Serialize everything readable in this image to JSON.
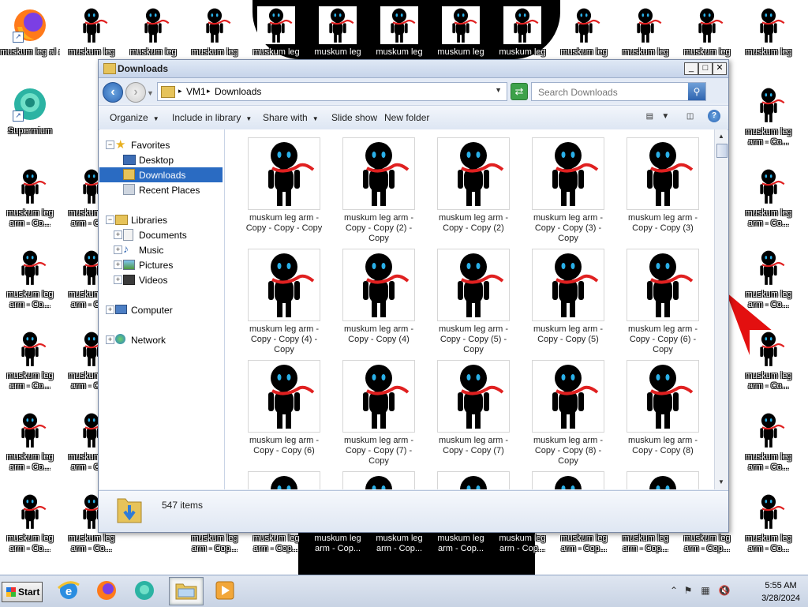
{
  "desktop": {
    "icons": [
      {
        "label_top": "Mozilla Firefox",
        "label_bottom": "",
        "kind": "firefox",
        "overlay": "muskum leg al arm - Copy..."
      },
      {
        "label_top": "Supermium",
        "label_bottom": "",
        "kind": "supermium"
      }
    ],
    "file_label_line1": "muskum leg",
    "file_label_line2": "arm - Co...",
    "top_row_label": "muskum leg",
    "bottom_center_label_line1": "muskum leg",
    "bottom_center_label_line2": "arm - Cop..."
  },
  "window": {
    "title": "Downloads",
    "caption_buttons": {
      "minimize": "_",
      "maximize": "□",
      "close": "✕"
    },
    "address": {
      "crumbs": [
        "VM1",
        "Downloads"
      ],
      "separator": "▸"
    },
    "search": {
      "placeholder": "Search Downloads"
    },
    "commands": {
      "organize": "Organize",
      "include": "Include in library",
      "share": "Share with",
      "slideshow": "Slide show",
      "newfolder": "New folder"
    },
    "nav": {
      "favorites": "Favorites",
      "desktop": "Desktop",
      "downloads": "Downloads",
      "recent": "Recent Places",
      "libraries": "Libraries",
      "documents": "Documents",
      "music": "Music",
      "pictures": "Pictures",
      "videos": "Videos",
      "computer": "Computer",
      "network": "Network"
    },
    "files": [
      "muskum leg arm - Copy - Copy - Copy",
      "muskum leg arm - Copy - Copy (2) - Copy",
      "muskum leg arm - Copy - Copy (2)",
      "muskum leg arm - Copy - Copy (3) - Copy",
      "muskum leg arm - Copy - Copy (3)",
      "muskum leg arm - Copy - Copy (4) - Copy",
      "muskum leg arm - Copy - Copy (4)",
      "muskum leg arm - Copy - Copy (5) - Copy",
      "muskum leg arm - Copy - Copy (5)",
      "muskum leg arm - Copy - Copy (6) - Copy",
      "muskum leg arm - Copy - Copy (6)",
      "muskum leg arm - Copy - Copy (7) - Copy",
      "muskum leg arm - Copy - Copy (7)",
      "muskum leg arm - Copy - Copy (8) - Copy",
      "muskum leg arm - Copy - Copy (8)"
    ],
    "status": {
      "item_count": "547 items"
    }
  },
  "taskbar": {
    "start": "Start",
    "time": "5:55 AM",
    "date": "3/28/2024"
  },
  "colors": {
    "accent": "#2a6bc2",
    "scarf": "#e02020",
    "eyes": "#2ab0e8",
    "title_text": "#1e1e1e"
  }
}
